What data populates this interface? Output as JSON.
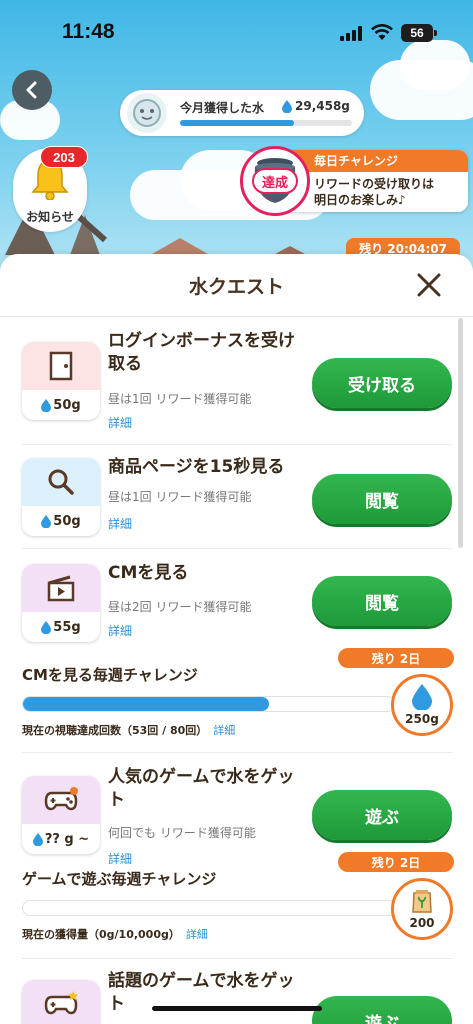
{
  "status_bar": {
    "time": "11:48",
    "battery": "56"
  },
  "header": {
    "water_label": "今月獲得した水",
    "water_value": "29,458g",
    "water_progress": 0.66,
    "notification_count": "203",
    "notification_label": "お知らせ",
    "daily_title": "毎日チャレンジ",
    "daily_line1": "リワードの受け取りは",
    "daily_line2": "明日のお楽しみ♪",
    "achieved_badge": "達成",
    "remaining_time": "残り 20:04:07"
  },
  "sheet": {
    "title": "水クエスト",
    "quests": [
      {
        "title": "ログインボーナスを受け取る",
        "amount": "50g",
        "sub": "昼は1回 リワード獲得可能",
        "detail": "詳細",
        "button": "受け取る",
        "icon": "door-icon"
      },
      {
        "title": "商品ページを15秒見る",
        "amount": "50g",
        "sub": "昼は1回 リワード獲得可能",
        "detail": "詳細",
        "button": "閲覧",
        "icon": "search-icon"
      },
      {
        "title": "CMを見る",
        "amount": "55g",
        "sub": "昼は2回 リワード獲得可能",
        "detail": "詳細",
        "button": "閲覧",
        "icon": "clapperboard-icon"
      },
      {
        "title": "人気のゲームで水をゲット",
        "amount": "?? g ~",
        "sub": "何回でも リワード獲得可能",
        "detail": "詳細",
        "button": "遊ぶ",
        "icon": "gamepad-icon"
      },
      {
        "title": "話題のゲームで水をゲット",
        "button": "遊ぶ",
        "icon": "gamepad-star-icon"
      }
    ],
    "weekly": [
      {
        "title": "CMを見る毎週チャレンジ",
        "note": "現在の視聴達成回数（53回 / 80回）",
        "detail": "詳細",
        "remaining": "残り 2日",
        "reward": "250g",
        "progress": 0.6625,
        "reward_icon": "water-drop-icon"
      },
      {
        "title": "ゲームで遊ぶ毎週チャレンジ",
        "note": "現在の獲得量（0g/10,000g）",
        "detail": "詳細",
        "remaining": "残り 2日",
        "reward": "200",
        "progress": 0.0,
        "reward_icon": "seed-bag-icon"
      }
    ]
  },
  "colors": {
    "accent_green": "#24a540",
    "accent_orange": "#f07a28",
    "progress_blue": "#2f9ae0",
    "link_blue": "#2d8fd6"
  }
}
